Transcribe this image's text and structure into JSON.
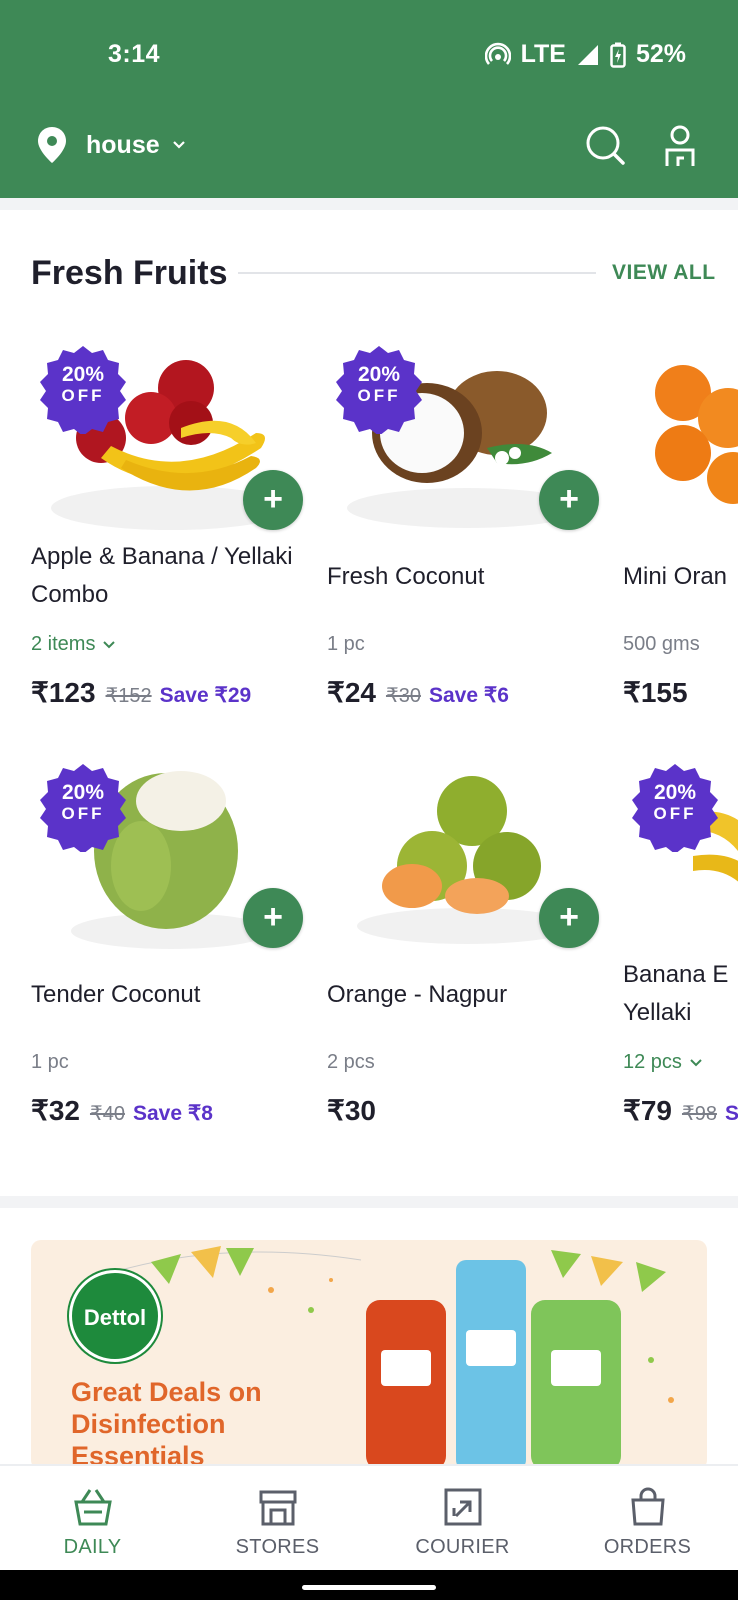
{
  "status": {
    "time": "3:14",
    "network": "LTE",
    "battery": "52%"
  },
  "header": {
    "location": "house"
  },
  "section": {
    "title": "Fresh Fruits",
    "view_all": "VIEW ALL"
  },
  "products": [
    {
      "name": "Apple & Banana / Yellaki Combo",
      "qty": "2 items",
      "qty_dropdown": true,
      "price": "₹123",
      "mrp": "₹152",
      "save": "Save ₹29",
      "badge_pct": "20%",
      "badge_off": "OFF"
    },
    {
      "name": "Fresh Coconut",
      "qty": "1 pc",
      "price": "₹24",
      "mrp": "₹30",
      "save": "Save ₹6",
      "badge_pct": "20%",
      "badge_off": "OFF"
    },
    {
      "name": "Mini Oran",
      "qty": "500 gms",
      "price": "₹155"
    },
    {
      "name": "Tender Coconut",
      "qty": "1 pc",
      "price": "₹32",
      "mrp": "₹40",
      "save": "Save ₹8",
      "badge_pct": "20%",
      "badge_off": "OFF"
    },
    {
      "name": "Orange - Nagpur",
      "qty": "2 pcs",
      "price": "₹30"
    },
    {
      "name": "Banana E Yellaki",
      "qty": "12 pcs",
      "qty_dropdown": true,
      "price": "₹79",
      "mrp": "₹98",
      "save": "Sa",
      "badge_pct": "20%",
      "badge_off": "OFF"
    }
  ],
  "banner": {
    "brand": "Dettol",
    "text": "Great Deals on Disinfection Essentials"
  },
  "nav": [
    {
      "label": "DAILY",
      "icon": "basket-icon",
      "active": true
    },
    {
      "label": "STORES",
      "icon": "store-icon"
    },
    {
      "label": "COURIER",
      "icon": "courier-icon"
    },
    {
      "label": "ORDERS",
      "icon": "bag-icon"
    }
  ],
  "colors": {
    "primary": "#3e8956",
    "badge": "#5b33c9",
    "banner_text": "#e0662a"
  }
}
